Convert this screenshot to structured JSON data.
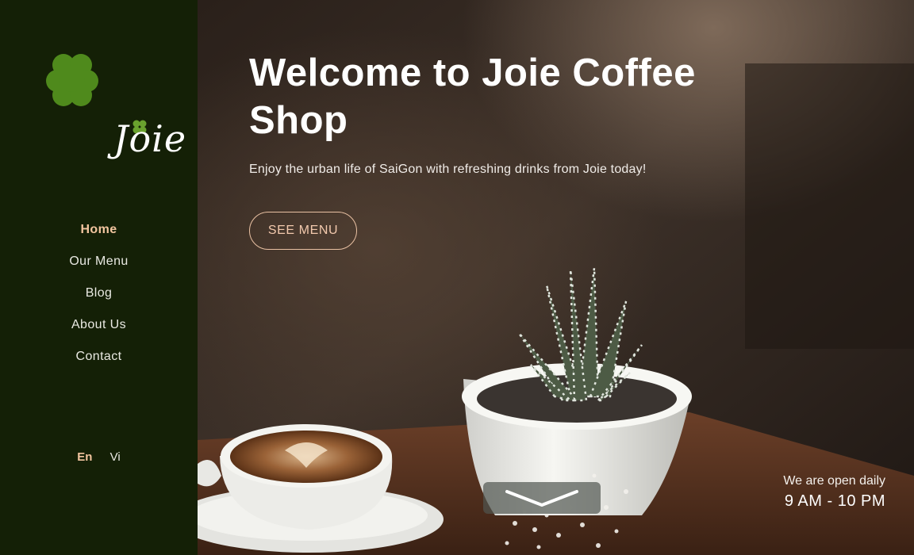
{
  "brand": {
    "logo_text": "Joie"
  },
  "sidebar": {
    "nav": [
      {
        "label": "Home",
        "active": true
      },
      {
        "label": "Our Menu"
      },
      {
        "label": "Blog"
      },
      {
        "label": "About Us"
      },
      {
        "label": "Contact"
      }
    ],
    "languages": [
      {
        "label": "En",
        "active": true
      },
      {
        "label": "Vi"
      }
    ]
  },
  "hero": {
    "title": "Welcome to Joie Coffee Shop",
    "subtitle": "Enjoy the urban life of SaiGon with refreshing drinks from Joie today!",
    "cta_label": "SEE MENU",
    "scroll_icon": "chevron-down-icon"
  },
  "hours": {
    "label": "We are open daily",
    "time": "9 AM - 10 PM"
  },
  "colors": {
    "sidebar_bg": "#142006",
    "accent": "#f2c59f",
    "logo_green": "#4f8a1c"
  }
}
